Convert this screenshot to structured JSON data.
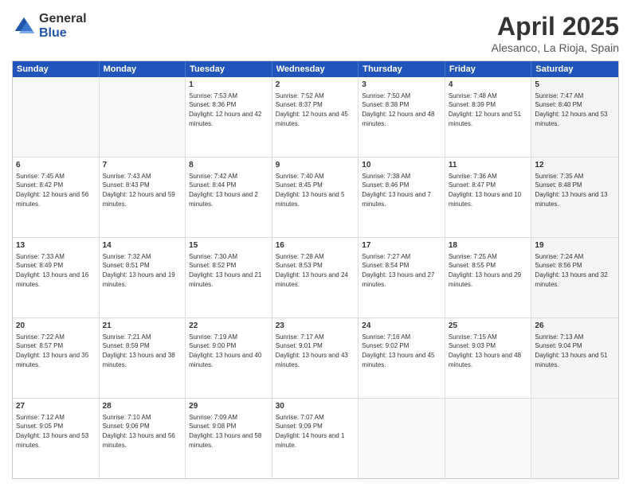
{
  "header": {
    "logo_general": "General",
    "logo_blue": "Blue",
    "title": "April 2025",
    "location": "Alesanco, La Rioja, Spain"
  },
  "days_of_week": [
    "Sunday",
    "Monday",
    "Tuesday",
    "Wednesday",
    "Thursday",
    "Friday",
    "Saturday"
  ],
  "rows": [
    [
      {
        "day": "",
        "empty": true
      },
      {
        "day": "",
        "empty": true
      },
      {
        "day": "1",
        "sunrise": "7:53 AM",
        "sunset": "8:36 PM",
        "daylight": "12 hours and 42 minutes."
      },
      {
        "day": "2",
        "sunrise": "7:52 AM",
        "sunset": "8:37 PM",
        "daylight": "12 hours and 45 minutes."
      },
      {
        "day": "3",
        "sunrise": "7:50 AM",
        "sunset": "8:38 PM",
        "daylight": "12 hours and 48 minutes."
      },
      {
        "day": "4",
        "sunrise": "7:48 AM",
        "sunset": "8:39 PM",
        "daylight": "12 hours and 51 minutes."
      },
      {
        "day": "5",
        "sunrise": "7:47 AM",
        "sunset": "8:40 PM",
        "daylight": "12 hours and 53 minutes.",
        "shaded": true
      }
    ],
    [
      {
        "day": "6",
        "sunrise": "7:45 AM",
        "sunset": "8:42 PM",
        "daylight": "12 hours and 56 minutes."
      },
      {
        "day": "7",
        "sunrise": "7:43 AM",
        "sunset": "8:43 PM",
        "daylight": "12 hours and 59 minutes."
      },
      {
        "day": "8",
        "sunrise": "7:42 AM",
        "sunset": "8:44 PM",
        "daylight": "13 hours and 2 minutes."
      },
      {
        "day": "9",
        "sunrise": "7:40 AM",
        "sunset": "8:45 PM",
        "daylight": "13 hours and 5 minutes."
      },
      {
        "day": "10",
        "sunrise": "7:38 AM",
        "sunset": "8:46 PM",
        "daylight": "13 hours and 7 minutes."
      },
      {
        "day": "11",
        "sunrise": "7:36 AM",
        "sunset": "8:47 PM",
        "daylight": "13 hours and 10 minutes."
      },
      {
        "day": "12",
        "sunrise": "7:35 AM",
        "sunset": "8:48 PM",
        "daylight": "13 hours and 13 minutes.",
        "shaded": true
      }
    ],
    [
      {
        "day": "13",
        "sunrise": "7:33 AM",
        "sunset": "8:49 PM",
        "daylight": "13 hours and 16 minutes."
      },
      {
        "day": "14",
        "sunrise": "7:32 AM",
        "sunset": "8:51 PM",
        "daylight": "13 hours and 19 minutes."
      },
      {
        "day": "15",
        "sunrise": "7:30 AM",
        "sunset": "8:52 PM",
        "daylight": "13 hours and 21 minutes."
      },
      {
        "day": "16",
        "sunrise": "7:28 AM",
        "sunset": "8:53 PM",
        "daylight": "13 hours and 24 minutes."
      },
      {
        "day": "17",
        "sunrise": "7:27 AM",
        "sunset": "8:54 PM",
        "daylight": "13 hours and 27 minutes."
      },
      {
        "day": "18",
        "sunrise": "7:25 AM",
        "sunset": "8:55 PM",
        "daylight": "13 hours and 29 minutes."
      },
      {
        "day": "19",
        "sunrise": "7:24 AM",
        "sunset": "8:56 PM",
        "daylight": "13 hours and 32 minutes.",
        "shaded": true
      }
    ],
    [
      {
        "day": "20",
        "sunrise": "7:22 AM",
        "sunset": "8:57 PM",
        "daylight": "13 hours and 35 minutes."
      },
      {
        "day": "21",
        "sunrise": "7:21 AM",
        "sunset": "8:59 PM",
        "daylight": "13 hours and 38 minutes."
      },
      {
        "day": "22",
        "sunrise": "7:19 AM",
        "sunset": "9:00 PM",
        "daylight": "13 hours and 40 minutes."
      },
      {
        "day": "23",
        "sunrise": "7:17 AM",
        "sunset": "9:01 PM",
        "daylight": "13 hours and 43 minutes."
      },
      {
        "day": "24",
        "sunrise": "7:16 AM",
        "sunset": "9:02 PM",
        "daylight": "13 hours and 45 minutes."
      },
      {
        "day": "25",
        "sunrise": "7:15 AM",
        "sunset": "9:03 PM",
        "daylight": "13 hours and 48 minutes."
      },
      {
        "day": "26",
        "sunrise": "7:13 AM",
        "sunset": "9:04 PM",
        "daylight": "13 hours and 51 minutes.",
        "shaded": true
      }
    ],
    [
      {
        "day": "27",
        "sunrise": "7:12 AM",
        "sunset": "9:05 PM",
        "daylight": "13 hours and 53 minutes."
      },
      {
        "day": "28",
        "sunrise": "7:10 AM",
        "sunset": "9:06 PM",
        "daylight": "13 hours and 56 minutes."
      },
      {
        "day": "29",
        "sunrise": "7:09 AM",
        "sunset": "9:08 PM",
        "daylight": "13 hours and 58 minutes."
      },
      {
        "day": "30",
        "sunrise": "7:07 AM",
        "sunset": "9:09 PM",
        "daylight": "14 hours and 1 minute."
      },
      {
        "day": "",
        "empty": true
      },
      {
        "day": "",
        "empty": true
      },
      {
        "day": "",
        "empty": true,
        "shaded": true
      }
    ]
  ]
}
